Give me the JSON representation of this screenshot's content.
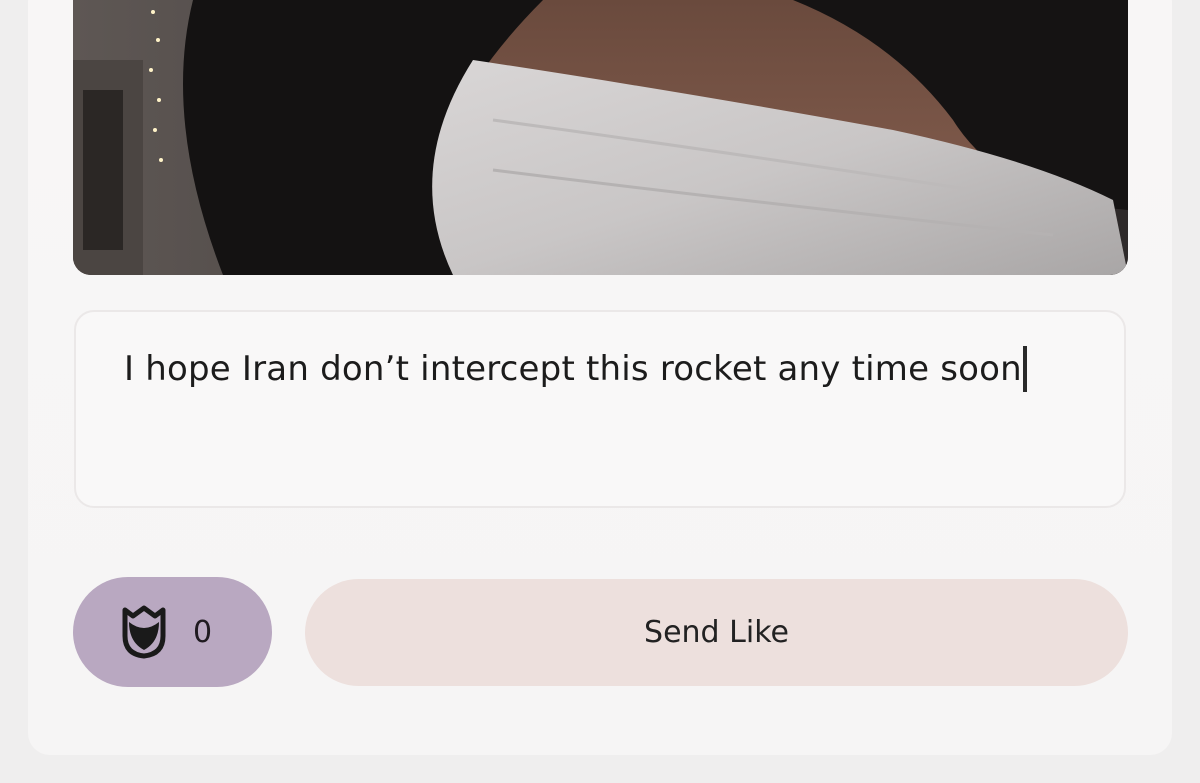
{
  "photo": {
    "alt_icon": "profile-photo"
  },
  "comment": {
    "value": "I hope Iran don’t intercept this rocket any time soon"
  },
  "rose": {
    "icon": "rose-icon",
    "count": "0"
  },
  "send_like": {
    "label": "Send Like"
  },
  "colors": {
    "rose_button_bg": "#b9a8c1",
    "send_button_bg": "#ede0dd",
    "card_bg": "#f7f5f5"
  }
}
